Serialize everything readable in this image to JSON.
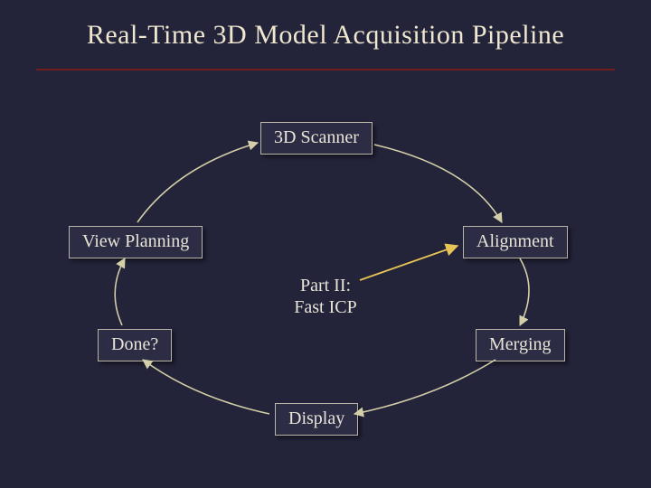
{
  "title": "Real-Time 3D Model Acquisition Pipeline",
  "nodes": {
    "scanner": "3D Scanner",
    "planning": "View Planning",
    "alignment": "Alignment",
    "done": "Done?",
    "merging": "Merging",
    "display": "Display"
  },
  "center": {
    "line1": "Part II:",
    "line2": "Fast ICP"
  }
}
